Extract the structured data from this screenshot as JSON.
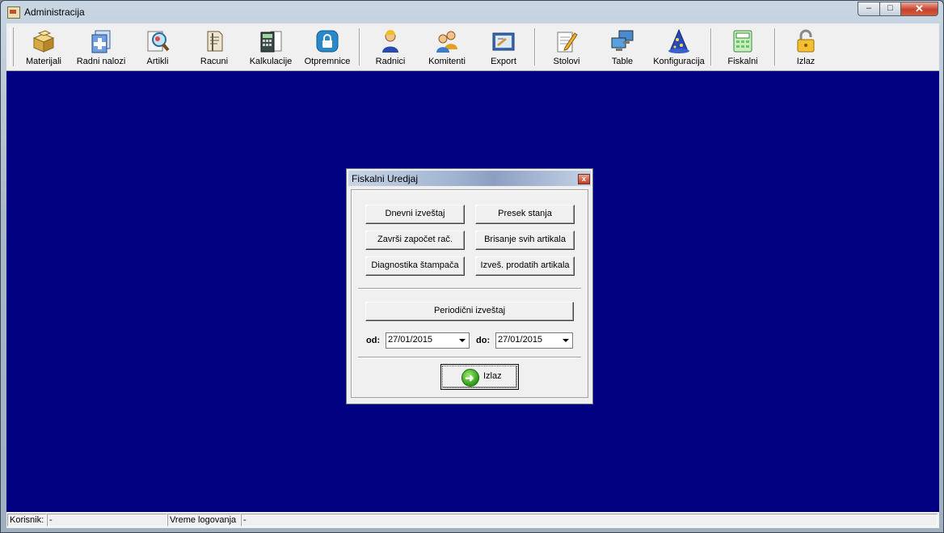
{
  "window": {
    "title": "Administracija",
    "min": "–",
    "max": "□",
    "close": "✕"
  },
  "toolbar": {
    "items": [
      {
        "label": "Materijali",
        "icon": "boxes-icon"
      },
      {
        "label": "Radni nalozi",
        "icon": "work-order-icon"
      },
      {
        "label": "Artikli",
        "icon": "magnifier-icon"
      },
      {
        "label": "Racuni",
        "icon": "receipt-icon"
      },
      {
        "label": "Kalkulacije",
        "icon": "calculator-icon"
      },
      {
        "label": "Otpremnice",
        "icon": "lock-badge-icon"
      },
      {
        "label": "Radnici",
        "icon": "worker-icon"
      },
      {
        "label": "Komitenti",
        "icon": "people-icon"
      },
      {
        "label": "Export",
        "icon": "export-icon"
      },
      {
        "label": "Stolovi",
        "icon": "pencil-paper-icon"
      },
      {
        "label": "Table",
        "icon": "computers-icon"
      },
      {
        "label": "Konfiguracija",
        "icon": "wizard-hat-icon"
      },
      {
        "label": "Fiskalni",
        "icon": "cash-register-icon"
      },
      {
        "label": "Izlaz",
        "icon": "padlock-open-icon"
      }
    ]
  },
  "dialog": {
    "title": "Fiskalni Uredjaj",
    "close": "x",
    "buttons": {
      "dnevni": "Dnevni izveštaj",
      "presek": "Presek stanja",
      "zavrsi": "Završi započet rač.",
      "brisanje": "Brisanje svih artikala",
      "diagnostika": "Diagnostika štampača",
      "izvestaj_prodatih": "Izveš. prodatih artikala",
      "periodicni": "Periodični izveštaj",
      "izlaz": "Izlaz"
    },
    "od_label": "od:",
    "do_label": "do:",
    "date_from": "27/01/2015",
    "date_to": "27/01/2015"
  },
  "status": {
    "korisnik_label": "Korisnik:",
    "korisnik_value": "-",
    "vreme_label": "Vreme logovanja",
    "vreme_value": "-"
  },
  "colors": {
    "desktop": "#000080",
    "face": "#f0f0f0"
  }
}
